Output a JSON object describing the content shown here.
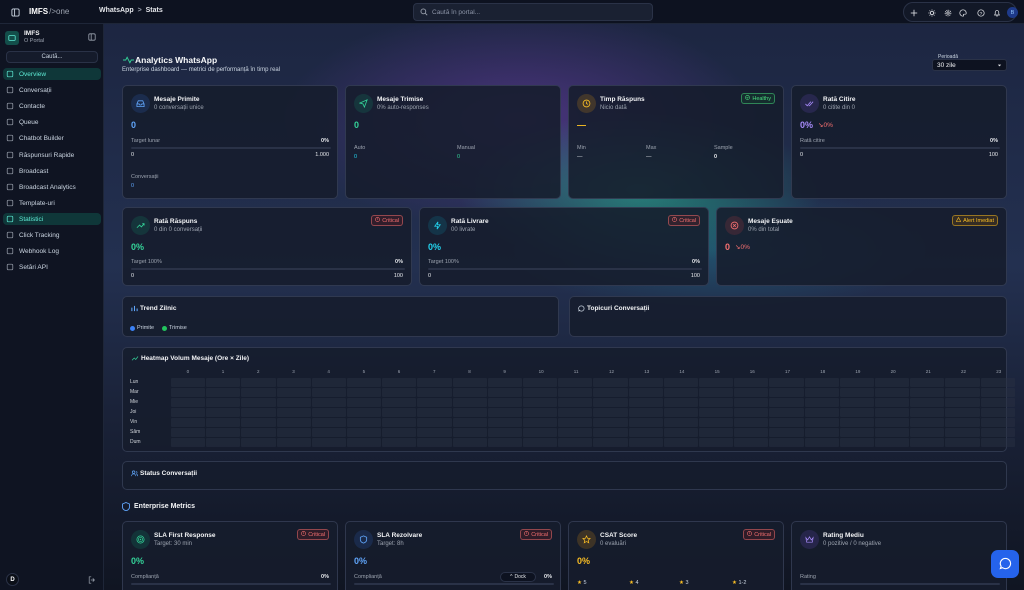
{
  "topbar": {
    "brand": "IMFS",
    "brand_suffix": "/>one",
    "crumb_1": "WhatsApp",
    "crumb_sep": ">",
    "crumb_2": "Stats",
    "search_placeholder": "Caută în portal...",
    "avatar": "B"
  },
  "sidebar": {
    "org_name": "IMFS",
    "org_sub": "O Portal",
    "search_label": "Caută...",
    "user_initial": "D",
    "items": [
      {
        "label": "Overview",
        "icon": "grid-icon"
      },
      {
        "label": "Conversații",
        "icon": "chat-icon"
      },
      {
        "label": "Contacte",
        "icon": "users-icon"
      },
      {
        "label": "Queue",
        "icon": "inbox-icon"
      },
      {
        "label": "Chatbot Builder",
        "icon": "bot-icon"
      },
      {
        "label": "Răspunsuri Rapide",
        "icon": "lightning-icon"
      },
      {
        "label": "Broadcast",
        "icon": "megaphone-icon"
      },
      {
        "label": "Broadcast Analytics",
        "icon": "chart-icon"
      },
      {
        "label": "Template-uri",
        "icon": "file-icon"
      },
      {
        "label": "Statistici",
        "icon": "bar-chart-icon"
      },
      {
        "label": "Click Tracking",
        "icon": "pointer-icon"
      },
      {
        "label": "Webhook Log",
        "icon": "webhook-icon"
      },
      {
        "label": "Setări API",
        "icon": "gear-icon"
      }
    ]
  },
  "header": {
    "title": "Analytics WhatsApp",
    "subtitle": "Enterprise dashboard — metrici de performanță în timp real",
    "period_label": "Perioadă",
    "period_value": "30 zile"
  },
  "cards_row1": [
    {
      "title": "Mesaje Primite",
      "sub": "0 conversații unice",
      "value": "0",
      "target_label": "Target lunar",
      "target_pct": "0%",
      "range_min": "0",
      "range_max": "1.000",
      "extra_label": "Conversații",
      "extra_value": "0",
      "color": "#60a5fa"
    },
    {
      "title": "Mesaje Trimise",
      "sub": "0% auto-responses",
      "value": "0",
      "auto_label": "Auto",
      "auto_value": "0",
      "manual_label": "Manual",
      "manual_value": "0",
      "color": "#34d399"
    },
    {
      "title": "Timp Răspuns",
      "sub": "Nicio dată",
      "value": "—",
      "badge": "Healthy",
      "min_label": "Min",
      "min_value": "—",
      "max_label": "Max",
      "max_value": "—",
      "sample_label": "Sample",
      "sample_value": "0",
      "color": "#fbbf24"
    },
    {
      "title": "Rată Citire",
      "sub": "0 citite din 0",
      "value": "0%",
      "trend": "0%",
      "target_label": "Rată citire",
      "target_pct": "0%",
      "range_min": "0",
      "range_max": "100",
      "color": "#a78bfa"
    }
  ],
  "cards_row2": [
    {
      "title": "Rată Răspuns",
      "sub": "0 din 0 conversații",
      "value": "0%",
      "badge": "Critical",
      "target_label": "Target 100%",
      "target_pct": "0%",
      "range_min": "0",
      "range_max": "100",
      "color": "#34d399"
    },
    {
      "title": "Rată Livrare",
      "sub": "00 livrate",
      "value": "0%",
      "badge": "Critical",
      "target_label": "Target 100%",
      "target_pct": "0%",
      "range_min": "0",
      "range_max": "100",
      "color": "#22d3ee"
    },
    {
      "title": "Mesaje Eșuate",
      "sub": "0% din total",
      "value": "0",
      "trend": "0%",
      "badge": "Alert Imediat",
      "color": "#f87171"
    }
  ],
  "trend": {
    "title": "Trend Zilnic",
    "legend_1": "Primite",
    "legend_2": "Trimise"
  },
  "topics": {
    "title": "Topicuri Conversații"
  },
  "heatmap": {
    "title": "Heatmap Volum Mesaje (Ore × Zile)",
    "days": [
      "Lun",
      "Mar",
      "Mie",
      "Joi",
      "Vin",
      "Sâm",
      "Dum"
    ],
    "hours": [
      "0",
      "1",
      "2",
      "3",
      "4",
      "5",
      "6",
      "7",
      "8",
      "9",
      "10",
      "11",
      "12",
      "13",
      "14",
      "15",
      "16",
      "17",
      "18",
      "19",
      "20",
      "21",
      "22",
      "23"
    ]
  },
  "status": {
    "title": "Status Conversații"
  },
  "enterprise": {
    "title": "Enterprise Metrics",
    "cards": [
      {
        "title": "SLA First Response",
        "sub": "Target: 30 min",
        "value": "0%",
        "badge": "Critical",
        "comp_label": "Complianță",
        "comp_pct": "0%",
        "color": "#34d399"
      },
      {
        "title": "SLA Rezolvare",
        "sub": "Target: 8h",
        "value": "0%",
        "badge": "Critical",
        "comp_label": "Complianță",
        "comp_pct": "0%",
        "color": "#60a5fa"
      },
      {
        "title": "CSAT Score",
        "sub": "0 evaluări",
        "value": "0%",
        "badge": "Critical",
        "stars": [
          "5",
          "4",
          "3",
          "1-2"
        ],
        "color": "#fbbf24"
      },
      {
        "title": "Rating Mediu",
        "sub": "0 pozitive / 0 negative",
        "value": "",
        "comp_label": "Rating",
        "color": "#a78bfa"
      }
    ]
  },
  "dock": {
    "label": "Dock"
  }
}
